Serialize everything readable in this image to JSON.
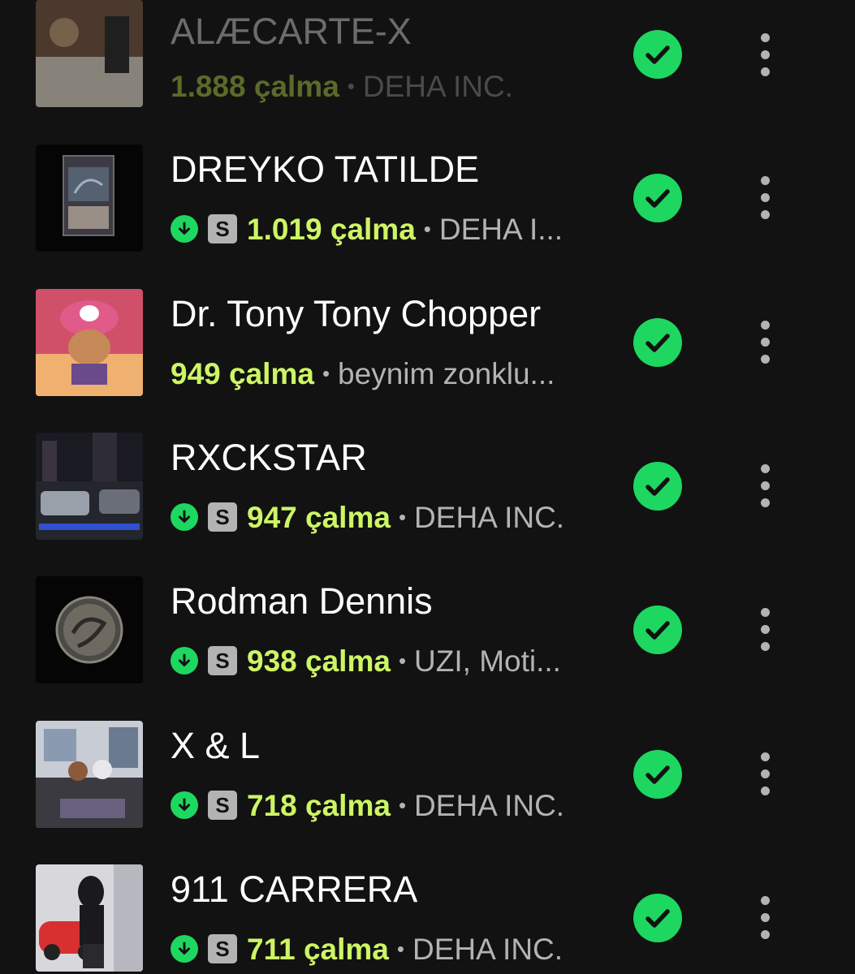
{
  "tracks": [
    {
      "title": "ALÆCARTE-X",
      "plays": "1.888 çalma",
      "artist": "DEHA INC.",
      "downloaded": false,
      "explicit": false,
      "saved": true
    },
    {
      "title": "DREYKO TATILDE",
      "plays": "1.019 çalma",
      "artist": "DEHA I...",
      "downloaded": true,
      "explicit": true,
      "saved": true
    },
    {
      "title": "Dr. Tony Tony Chopper",
      "plays": "949 çalma",
      "artist": "beynim zonklu...",
      "downloaded": false,
      "explicit": false,
      "saved": true
    },
    {
      "title": "RXCKSTAR",
      "plays": "947 çalma",
      "artist": "DEHA INC.",
      "downloaded": true,
      "explicit": true,
      "saved": true
    },
    {
      "title": "Rodman Dennis",
      "plays": "938 çalma",
      "artist": "UZI, Moti...",
      "downloaded": true,
      "explicit": true,
      "saved": true
    },
    {
      "title": "X & L",
      "plays": "718 çalma",
      "artist": "DEHA INC.",
      "downloaded": true,
      "explicit": true,
      "saved": true
    },
    {
      "title": "911 CARRERA",
      "plays": "711 çalma",
      "artist": "DEHA INC.",
      "downloaded": true,
      "explicit": true,
      "saved": true
    }
  ],
  "badges": {
    "explicit": "S",
    "separator": "•"
  },
  "icons": {
    "downloaded": "download-arrow-icon",
    "saved": "checkmark-circle-icon",
    "more": "more-options-icon"
  },
  "colors": {
    "background": "#121212",
    "accent": "#1ed760",
    "plays": "#cdf564",
    "secondary": "#b3b3b3"
  }
}
